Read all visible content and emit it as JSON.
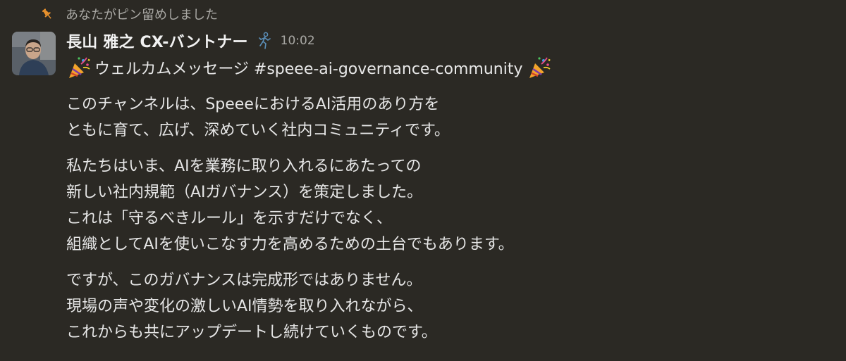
{
  "pin": {
    "icon": "pin-icon",
    "text": "あなたがピン留めしました",
    "icon_color": "#e8912d"
  },
  "message": {
    "avatar": "avatar",
    "author": "長山 雅之 CX-バントナー",
    "status_icon": "runner-icon",
    "time": "10:02",
    "title": "ウェルカムメッセージ #speee-ai-governance-community",
    "title_icons": [
      "party-popper-icon",
      "party-popper-icon"
    ],
    "paragraphs": [
      {
        "lines": [
          "このチャンネルは、SpeeeにおけるAI活用のあり方を",
          "ともに育て、広げ、深めていく社内コミュニティです。"
        ]
      },
      {
        "lines": [
          "私たちはいま、AIを業務に取り入れるにあたっての",
          "新しい社内規範（AIガバナンス）を策定しました。",
          "これは「守るべきルール」を示すだけでなく、",
          "組織としてAIを使いこなす力を高めるための土台でもあります。"
        ]
      },
      {
        "lines": [
          "ですが、このガバナンスは完成形ではありません。",
          "現場の声や変化の激しいAI情勢を取り入れながら、",
          "これからも共にアップデートし続けていくものです。"
        ]
      }
    ]
  },
  "colors": {
    "background": "#2b2924",
    "text": "#e6e6e6",
    "muted": "#a9a8a4"
  }
}
